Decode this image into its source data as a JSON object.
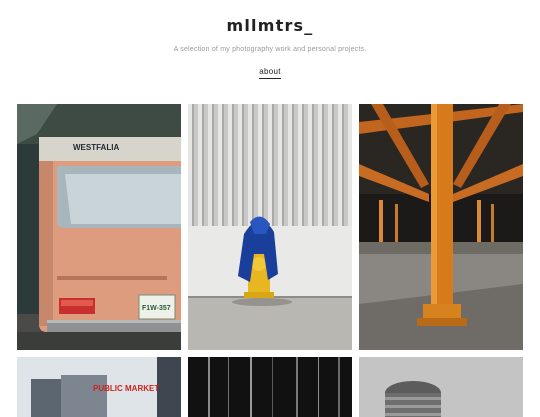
{
  "header": {
    "site_title": "mllmtrs_",
    "tagline": "A selection of my photography work and personal projects.",
    "about_label": "about"
  },
  "photos": [
    {
      "van_brand": "WESTFALIA",
      "plate": "F1W-357"
    },
    {},
    {},
    {
      "sign_text": "PUBLIC MARKET"
    },
    {},
    {}
  ],
  "colors": {
    "background": "#ffffff",
    "text": "#222222",
    "muted": "#9a9a9a"
  }
}
